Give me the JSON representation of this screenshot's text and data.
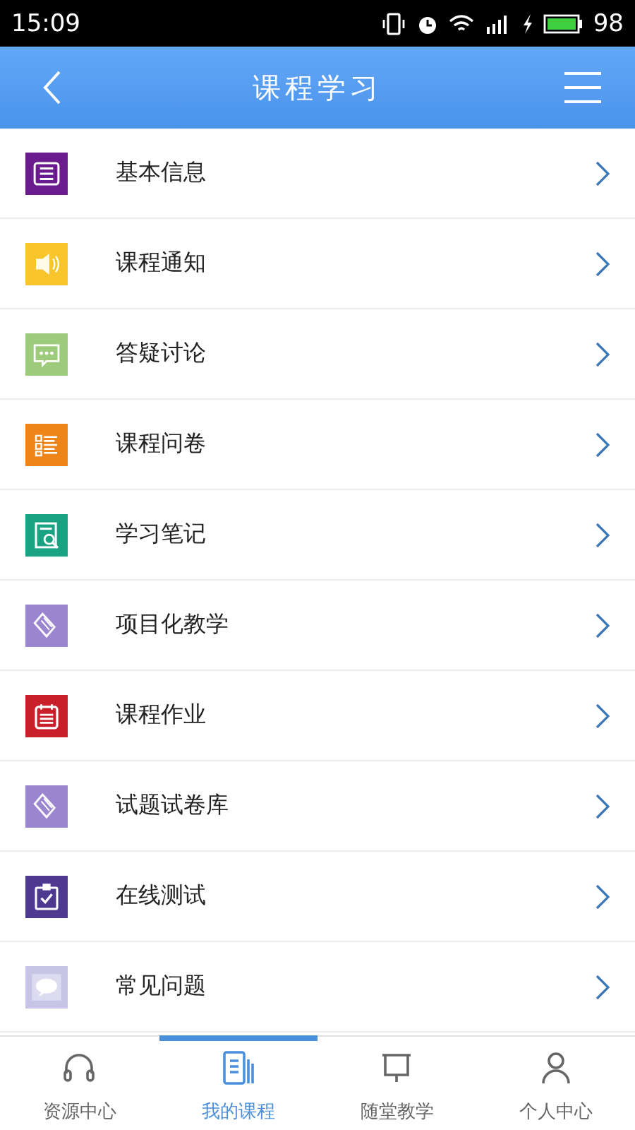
{
  "status_bar": {
    "time": "15:09",
    "battery": "98"
  },
  "header": {
    "title": "课程学习"
  },
  "menu": [
    {
      "label": "基本信息",
      "kind": "list",
      "color": "#6a1b8e"
    },
    {
      "label": "课程通知",
      "kind": "speaker",
      "color": "#f8c62c"
    },
    {
      "label": "答疑讨论",
      "kind": "chat",
      "color": "#9dcb7b"
    },
    {
      "label": "课程问卷",
      "kind": "checklist",
      "color": "#ef8419"
    },
    {
      "label": "学习笔记",
      "kind": "note",
      "color": "#1aa383"
    },
    {
      "label": "项目化教学",
      "kind": "scroll",
      "color": "#9b85d0"
    },
    {
      "label": "课程作业",
      "kind": "calendar",
      "color": "#c91f2b"
    },
    {
      "label": "试题试卷库",
      "kind": "scroll",
      "color": "#9b85d0"
    },
    {
      "label": "在线测试",
      "kind": "clipboard",
      "color": "#4d3990"
    },
    {
      "label": "常见问题",
      "kind": "bubble",
      "color": "#c7c4e5"
    }
  ],
  "tabs": [
    {
      "label": "资源中心",
      "kind": "headphones",
      "selected": false
    },
    {
      "label": "我的课程",
      "kind": "document",
      "selected": true
    },
    {
      "label": "随堂教学",
      "kind": "board",
      "selected": false
    },
    {
      "label": "个人中心",
      "kind": "person",
      "selected": false
    }
  ]
}
